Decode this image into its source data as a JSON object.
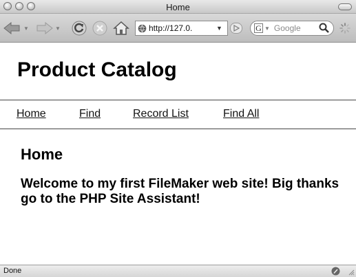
{
  "window": {
    "title": "Home"
  },
  "toolbar": {
    "url": "http://127.0.",
    "search_placeholder": "Google"
  },
  "page": {
    "title": "Product Catalog",
    "nav": [
      {
        "label": "Home"
      },
      {
        "label": "Find"
      },
      {
        "label": "Record List"
      },
      {
        "label": "Find All"
      }
    ],
    "section_title": "Home",
    "welcome": "Welcome to my first FileMaker web site! Big thanks go to the PHP Site Assistant!"
  },
  "status": {
    "text": "Done"
  },
  "icons": {
    "back": "back-arrow-icon",
    "forward": "forward-arrow-icon",
    "reload": "reload-icon",
    "stop": "stop-icon",
    "home": "home-icon",
    "site": "globe-icon",
    "go": "play-icon",
    "search_engine": "google-icon",
    "search": "magnifier-icon",
    "loading": "spinner-icon",
    "status": "pencil-icon"
  },
  "colors": {
    "text": "#000000",
    "link": "#111111",
    "chrome": "#c8c8c8"
  }
}
